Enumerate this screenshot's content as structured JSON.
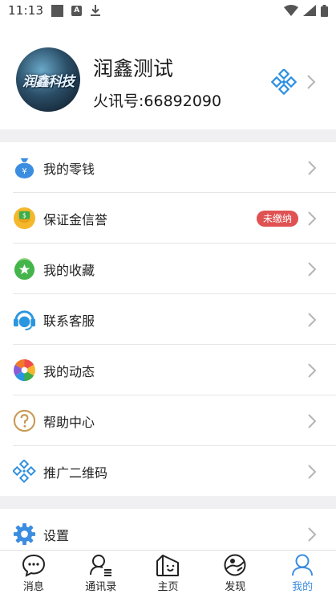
{
  "status_bar": {
    "time": "11:13",
    "a_badge": "A"
  },
  "profile": {
    "avatar_text": "润鑫科技",
    "name": "润鑫测试",
    "id_text": "火讯号:66892090"
  },
  "menu": [
    {
      "label": "我的零钱",
      "icon": "money-bag-icon"
    },
    {
      "label": "保证金信誉",
      "icon": "deposit-icon",
      "badge": "未缴纳"
    },
    {
      "label": "我的收藏",
      "icon": "favorite-star-icon"
    },
    {
      "label": "联系客服",
      "icon": "headset-icon"
    },
    {
      "label": "我的动态",
      "icon": "pinwheel-icon"
    },
    {
      "label": "帮助中心",
      "icon": "question-icon"
    },
    {
      "label": "推广二维码",
      "icon": "qrcode-icon"
    }
  ],
  "settings": {
    "label": "设置",
    "icon": "gear-icon"
  },
  "tabs": [
    {
      "label": "消息",
      "icon": "chat-icon"
    },
    {
      "label": "通讯录",
      "icon": "contacts-icon"
    },
    {
      "label": "主页",
      "icon": "home-icon"
    },
    {
      "label": "发现",
      "icon": "discover-icon"
    },
    {
      "label": "我的",
      "icon": "profile-icon",
      "active": true
    }
  ],
  "colors": {
    "accent": "#3a8be0",
    "badge": "#e05151",
    "separator": "#f0f0f2"
  }
}
